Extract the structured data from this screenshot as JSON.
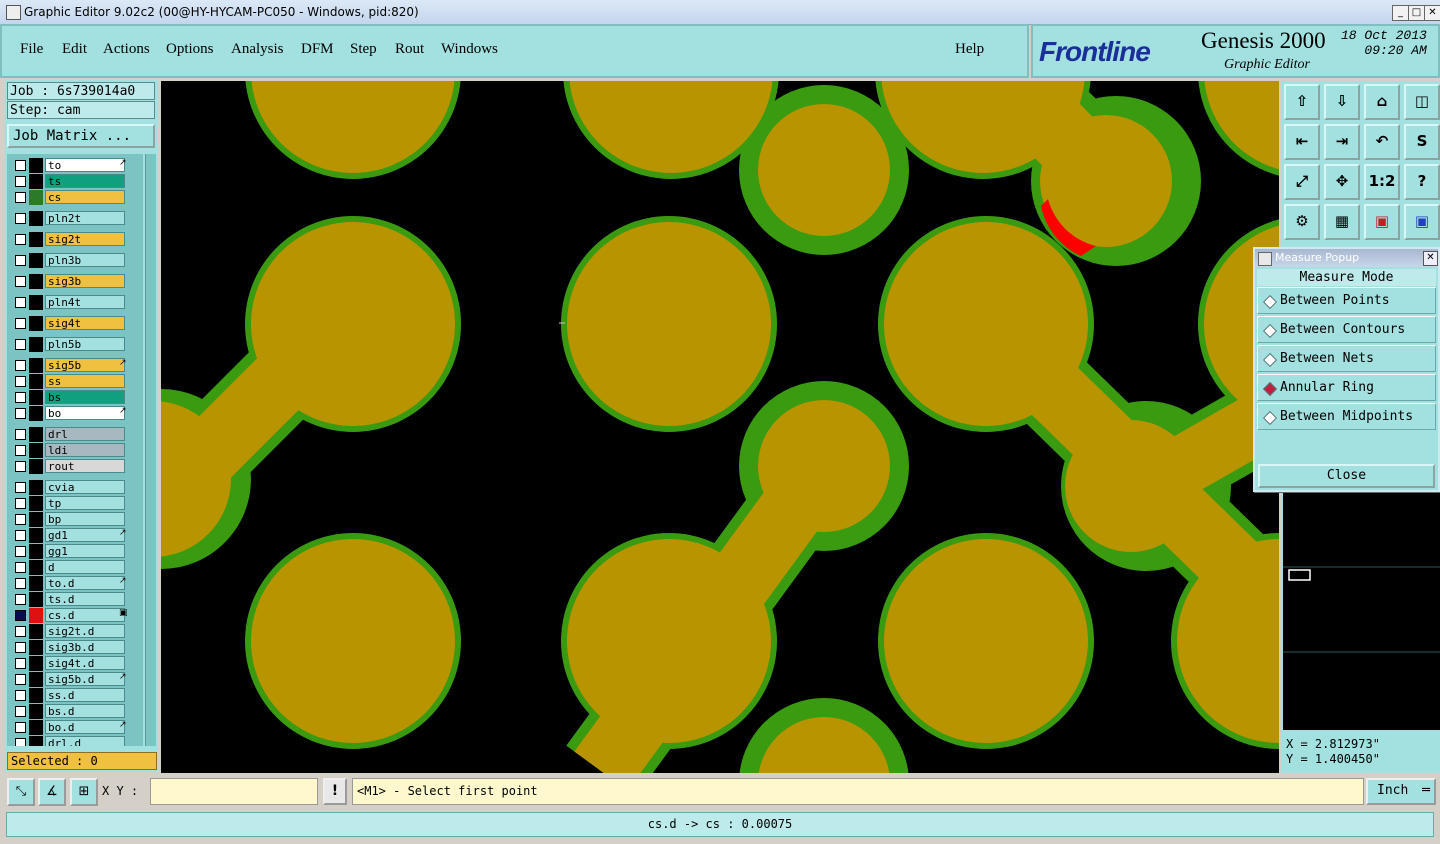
{
  "window": {
    "title": "Graphic Editor 9.02c2 (00@HY-HYCAM-PC050 - Windows, pid:820)"
  },
  "menu": {
    "items": [
      "File",
      "Edit",
      "Actions",
      "Options",
      "Analysis",
      "DFM",
      "Step",
      "Rout",
      "Windows"
    ],
    "help": "Help"
  },
  "brand": {
    "logo": "Frontline",
    "product": "Genesis 2000",
    "subtitle": "Graphic Editor",
    "date": "18 Oct 2013",
    "time": "09:20 AM"
  },
  "job": {
    "job_label": "Job : 6s739014a0",
    "step_label": "Step: cam",
    "matrix_button": "Job Matrix ..."
  },
  "layers": [
    {
      "name": "to",
      "color": "#ffffff",
      "mark": "↗"
    },
    {
      "name": "ts",
      "color": "#10a080",
      "mark": ""
    },
    {
      "name": "cs",
      "color": "#f0c040",
      "mark": "",
      "state": "#2a7a2a"
    },
    {
      "name": "pln2t",
      "color": "#a3e0e0",
      "mark": ""
    },
    {
      "name": "sig2t",
      "color": "#f0c040",
      "mark": ""
    },
    {
      "name": "pln3b",
      "color": "#a3e0e0",
      "mark": ""
    },
    {
      "name": "sig3b",
      "color": "#f0c040",
      "mark": ""
    },
    {
      "name": "pln4t",
      "color": "#a3e0e0",
      "mark": ""
    },
    {
      "name": "sig4t",
      "color": "#f0c040",
      "mark": ""
    },
    {
      "name": "pln5b",
      "color": "#a3e0e0",
      "mark": ""
    },
    {
      "name": "sig5b",
      "color": "#f0c040",
      "mark": "↗"
    },
    {
      "name": "ss",
      "color": "#f0c040",
      "mark": ""
    },
    {
      "name": "bs",
      "color": "#10a080",
      "mark": ""
    },
    {
      "name": "bo",
      "color": "#ffffff",
      "mark": "↗"
    },
    {
      "name": "drl",
      "color": "#a8b8c0",
      "mark": ""
    },
    {
      "name": "ldi",
      "color": "#a8b8c0",
      "mark": ""
    },
    {
      "name": "rout",
      "color": "#d8d8d8",
      "mark": ""
    },
    {
      "name": "cvia",
      "color": "#a3e0e0",
      "mark": ""
    },
    {
      "name": "tp",
      "color": "#a3e0e0",
      "mark": ""
    },
    {
      "name": "bp",
      "color": "#a3e0e0",
      "mark": ""
    },
    {
      "name": "gd1",
      "color": "#a3e0e0",
      "mark": "↗"
    },
    {
      "name": "gg1",
      "color": "#a3e0e0",
      "mark": ""
    },
    {
      "name": "d",
      "color": "#a3e0e0",
      "mark": ""
    },
    {
      "name": "to.d",
      "color": "#a3e0e0",
      "mark": "↗"
    },
    {
      "name": "ts.d",
      "color": "#a3e0e0",
      "mark": ""
    },
    {
      "name": "cs.d",
      "color": "#a3e0e0",
      "mark": "▣",
      "state": "#e01010",
      "active": true
    },
    {
      "name": "sig2t.d",
      "color": "#a3e0e0",
      "mark": ""
    },
    {
      "name": "sig3b.d",
      "color": "#a3e0e0",
      "mark": ""
    },
    {
      "name": "sig4t.d",
      "color": "#a3e0e0",
      "mark": ""
    },
    {
      "name": "sig5b.d",
      "color": "#a3e0e0",
      "mark": "↗"
    },
    {
      "name": "ss.d",
      "color": "#a3e0e0",
      "mark": ""
    },
    {
      "name": "bs.d",
      "color": "#a3e0e0",
      "mark": ""
    },
    {
      "name": "bo.d",
      "color": "#a3e0e0",
      "mark": "↗"
    },
    {
      "name": "drl.d",
      "color": "#a3e0e0",
      "mark": ""
    }
  ],
  "selected": "Selected : 0",
  "toolbar": {
    "icons": [
      "save-icon",
      "load-icon",
      "home-icon",
      "window-split-icon",
      "zoom-left-icon",
      "zoom-right-icon",
      "undo-icon",
      "route-icon",
      "zoom-fit-icon",
      "zoom-center-icon",
      "scale-icon",
      "help-icon",
      "filter-icon",
      "grid-icon",
      "layers-red-icon",
      "layers-blue-icon"
    ],
    "scale_label": "1:2",
    "help_label": "?"
  },
  "measure": {
    "title": "Measure Popup",
    "mode_label": "Measure Mode",
    "options": [
      "Between Points",
      "Between Contours",
      "Between Nets",
      "Annular Ring",
      "Between Midpoints"
    ],
    "selected": "Annular Ring",
    "close_label": "Close"
  },
  "coords": {
    "x": "X = 2.812973\"",
    "y": "Y = 1.400450\""
  },
  "input": {
    "xy_label": "X Y :",
    "xy_value": "",
    "prompt": "<M1> - Select first point",
    "units": "Inch"
  },
  "status": "cs.d -> cs : 0.00075",
  "colors": {
    "copper": "#b89400",
    "mask": "#3a9a10",
    "panel": "#a3e0e0",
    "error": "#ff0000"
  }
}
